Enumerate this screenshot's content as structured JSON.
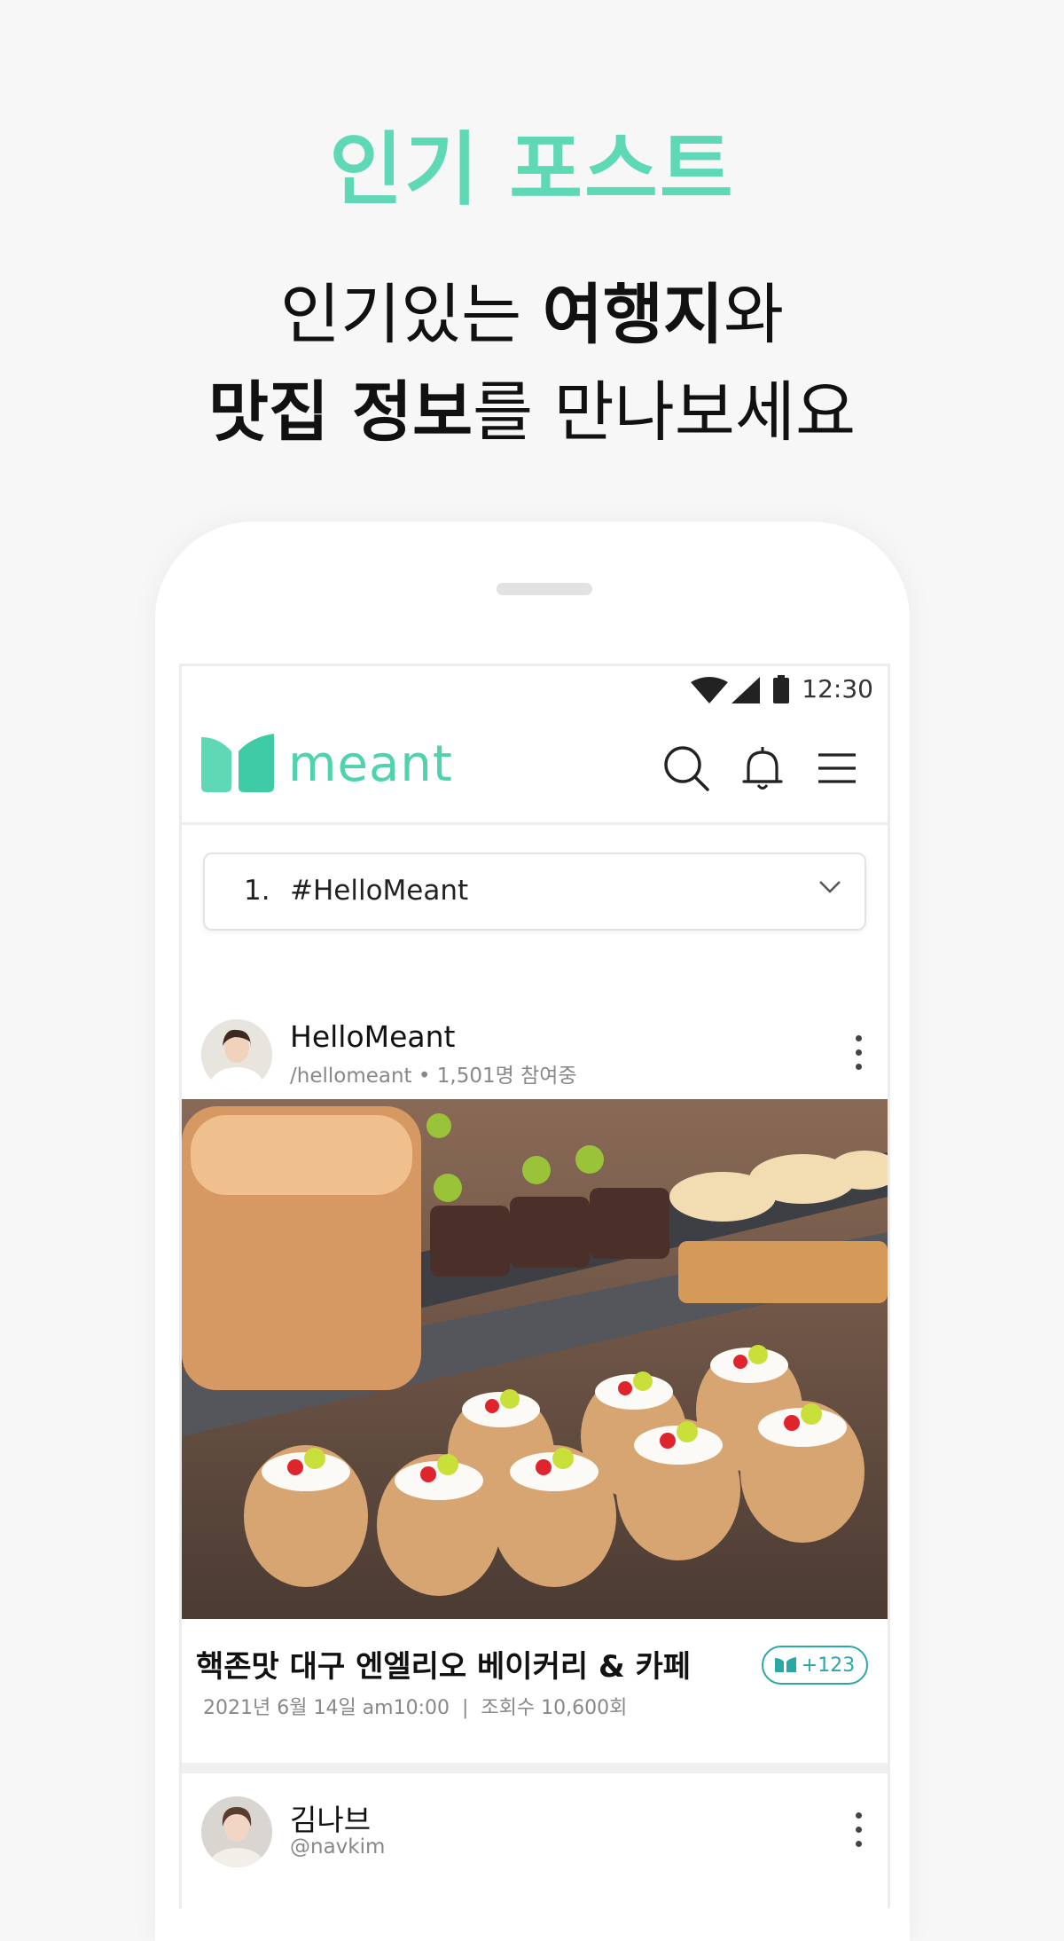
{
  "promo": {
    "headline": "인기 포스트",
    "line1_a": "인기있는 ",
    "line1_b": "여행지",
    "line1_c": "와",
    "line2_a": "맛집 정보",
    "line2_b": "를 만나보세요"
  },
  "status_bar": {
    "time": "12:30"
  },
  "app": {
    "logo_text": "meant",
    "brand_color": "#4fd2ad",
    "icons": [
      "search-icon",
      "bell-icon",
      "menu-icon"
    ]
  },
  "dropdown": {
    "rank": "1.",
    "tag": "#HelloMeant"
  },
  "posts": [
    {
      "name": "HelloMeant",
      "handle": "/hellomeant",
      "participants": "1,501명 참여중",
      "title": "핵존맛 대구 엔엘리오 베이커리 & 카페",
      "date": "2021년 6월 14일 am10:00",
      "views": "조회수 10,600회",
      "badge": "+123"
    },
    {
      "name": "김나브",
      "handle": "@navkim"
    }
  ]
}
